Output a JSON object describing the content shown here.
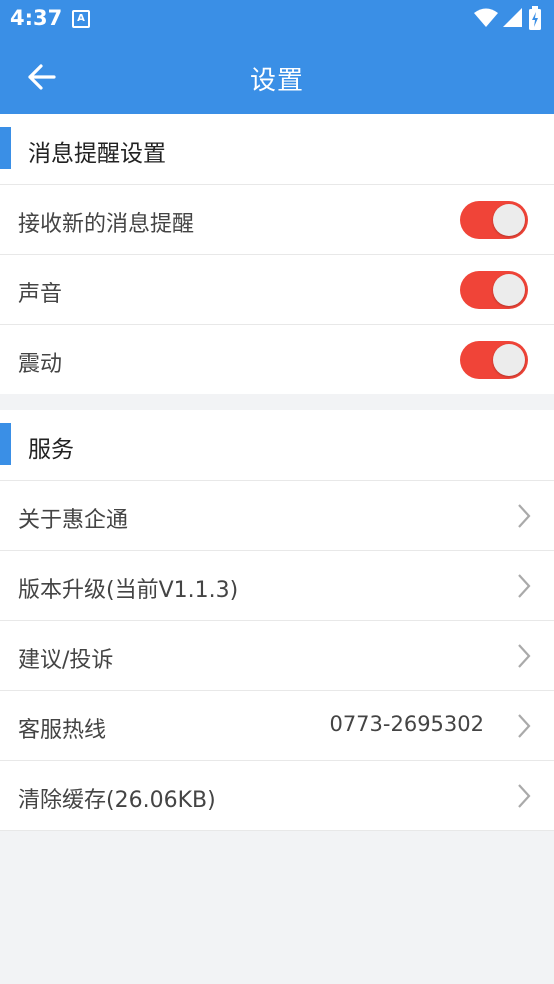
{
  "status_bar": {
    "time": "4:37",
    "notification_icon": "A"
  },
  "app_bar": {
    "title": "设置",
    "back_icon": "arrow-left-icon"
  },
  "colors": {
    "primary": "#3a8fe6",
    "toggle_on": "#f04438",
    "background": "#f2f3f5"
  },
  "notification_section": {
    "title": "消息提醒设置",
    "items": [
      {
        "label": "接收新的消息提醒",
        "enabled": true
      },
      {
        "label": "声音",
        "enabled": true
      },
      {
        "label": "震动",
        "enabled": true
      }
    ]
  },
  "service_section": {
    "title": "服务",
    "items": [
      {
        "label": "关于惠企通",
        "value": ""
      },
      {
        "label": "版本升级(当前V1.1.3)",
        "value": ""
      },
      {
        "label": "建议/投诉",
        "value": ""
      },
      {
        "label": "客服热线",
        "value": "0773-2695302"
      },
      {
        "label": "清除缓存(26.06KB)",
        "value": ""
      }
    ]
  }
}
